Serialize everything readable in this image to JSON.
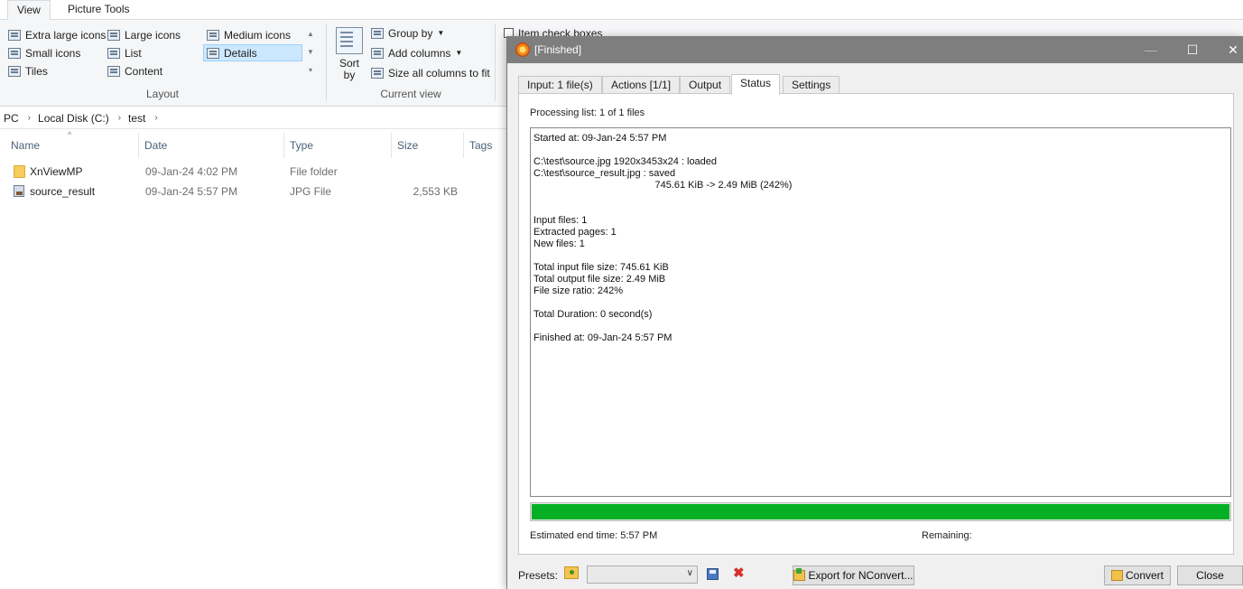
{
  "explorer": {
    "ribbon_tabs": [
      "View",
      "Picture Tools"
    ],
    "layout": {
      "items": [
        {
          "label": "Extra large icons",
          "icon": "extra-large-icons-icon"
        },
        {
          "label": "Large icons",
          "icon": "large-icons-icon"
        },
        {
          "label": "Medium icons",
          "icon": "medium-icons-icon"
        },
        {
          "label": "Small icons",
          "icon": "small-icons-icon"
        },
        {
          "label": "List",
          "icon": "list-icon"
        },
        {
          "label": "Details",
          "icon": "details-icon",
          "selected": true
        },
        {
          "label": "Tiles",
          "icon": "tiles-icon"
        },
        {
          "label": "Content",
          "icon": "content-icon"
        }
      ],
      "group_label": "Layout"
    },
    "current_view": {
      "sort_by": "Sort by",
      "group_by": "Group by",
      "add_columns": "Add columns",
      "size_all_columns": "Size all columns to fit",
      "group_label": "Current view"
    },
    "show_hide": {
      "item_check_boxes": "Item check boxes"
    },
    "breadcrumb": [
      "PC",
      "Local Disk (C:)",
      "test"
    ],
    "columns": [
      "Name",
      "Date",
      "Type",
      "Size",
      "Tags"
    ],
    "files": [
      {
        "name": "XnViewMP",
        "date": "09-Jan-24 4:02 PM",
        "type": "File folder",
        "size": "",
        "icon": "folder-icon"
      },
      {
        "name": "source_result",
        "date": "09-Jan-24 5:57 PM",
        "type": "JPG File",
        "size": "2,553 KB",
        "icon": "jpg-file-icon"
      }
    ]
  },
  "dialog": {
    "title": "[Finished]",
    "tabs": [
      "Input: 1 file(s)",
      "Actions [1/1]",
      "Output",
      "Status",
      "Settings"
    ],
    "active_tab": "Status",
    "processing_list": "Processing list:  1 of 1 files",
    "log": [
      "Started at: 09-Jan-24 5:57 PM",
      "",
      "C:\\test\\source.jpg 1920x3453x24 : loaded",
      "C:\\test\\source_result.jpg : saved",
      "                                            745.61 KiB -> 2.49 MiB (242%)",
      "",
      "",
      "Input files: 1",
      "Extracted pages: 1",
      "New files: 1",
      "",
      "Total input file size: 745.61 KiB",
      "Total output file size: 2.49 MiB",
      "File size ratio: 242%",
      "",
      "Total Duration: 0 second(s)",
      "",
      "Finished at: 09-Jan-24 5:57 PM"
    ],
    "progress_percent": 100,
    "progress_color": "#06b025",
    "estimated_end_time": "Estimated end time:  5:57 PM",
    "remaining": "Remaining:",
    "presets_label": "Presets:",
    "preset_value": "",
    "export_button": "Export for NConvert...",
    "convert_button": "Convert",
    "close_button": "Close"
  }
}
